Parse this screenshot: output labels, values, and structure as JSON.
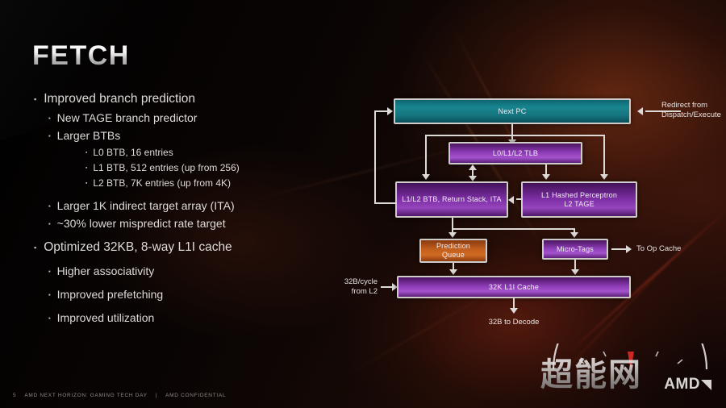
{
  "slide": {
    "title": "FETCH",
    "bullet_marker": "▪"
  },
  "bullets": [
    {
      "level": 1,
      "text": "Improved branch prediction"
    },
    {
      "level": 2,
      "text": "New TAGE branch predictor"
    },
    {
      "level": 2,
      "text": "Larger BTBs"
    },
    {
      "level": 3,
      "text": "L0 BTB, 16 entries"
    },
    {
      "level": 3,
      "text": "L1 BTB, 512 entries (up from 256)"
    },
    {
      "level": 3,
      "text": "L2 BTB, 7K entries (up from 4K)"
    },
    {
      "level": 2,
      "text": "Larger 1K indirect target array (ITA)"
    },
    {
      "level": 2,
      "text": "~30% lower mispredict rate target"
    },
    {
      "level": 1,
      "text": "Optimized 32KB, 8-way L1I cache"
    },
    {
      "level": 2,
      "text": "Higher associativity"
    },
    {
      "level": 2,
      "text": "Improved prefetching"
    },
    {
      "level": 2,
      "text": "Improved utilization"
    }
  ],
  "diagram": {
    "boxes": {
      "next_pc": "Next PC",
      "tlb": "L0/L1/L2 TLB",
      "btb": "L1/L2 BTB, Return Stack, ITA",
      "perceptron": "L1 Hashed Perceptron\nL2 TAGE",
      "prediction_queue": "Prediction\nQueue",
      "micro_tags": "Micro-Tags",
      "l1i_cache": "32K L1I Cache"
    },
    "labels": {
      "redirect": "Redirect from\nDispatch/Execute",
      "from_l2": "32B/cycle\nfrom L2",
      "to_op_cache": "To Op Cache",
      "to_decode": "32B to Decode"
    },
    "colors": {
      "teal": "#15757f",
      "purple": "#8c3bb4",
      "orange": "#c4601d",
      "connector": "#ddd9d6"
    }
  },
  "footer": {
    "page_number": "5",
    "event": "AMD NEXT HORIZON: GAMING TECH DAY",
    "separator": "|",
    "confidential": "AMD CONFIDENTIAL"
  },
  "branding": {
    "amd_logo_text": "AMD",
    "watermark_text": "超能网"
  }
}
